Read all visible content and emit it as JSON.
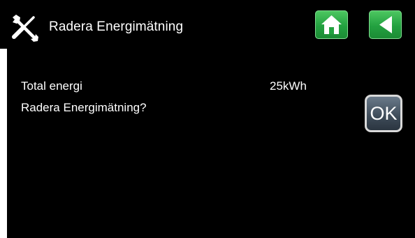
{
  "header": {
    "title": "Radera Energimätning",
    "left_icon": "wrench-screwdriver-icon",
    "home_icon": "home-icon",
    "back_icon": "back-arrow-icon",
    "button_color": "#23a140"
  },
  "content": {
    "total_label": "Total energi",
    "total_value": "25kWh",
    "question": "Radera Energimätning?",
    "ok_label": "OK"
  }
}
